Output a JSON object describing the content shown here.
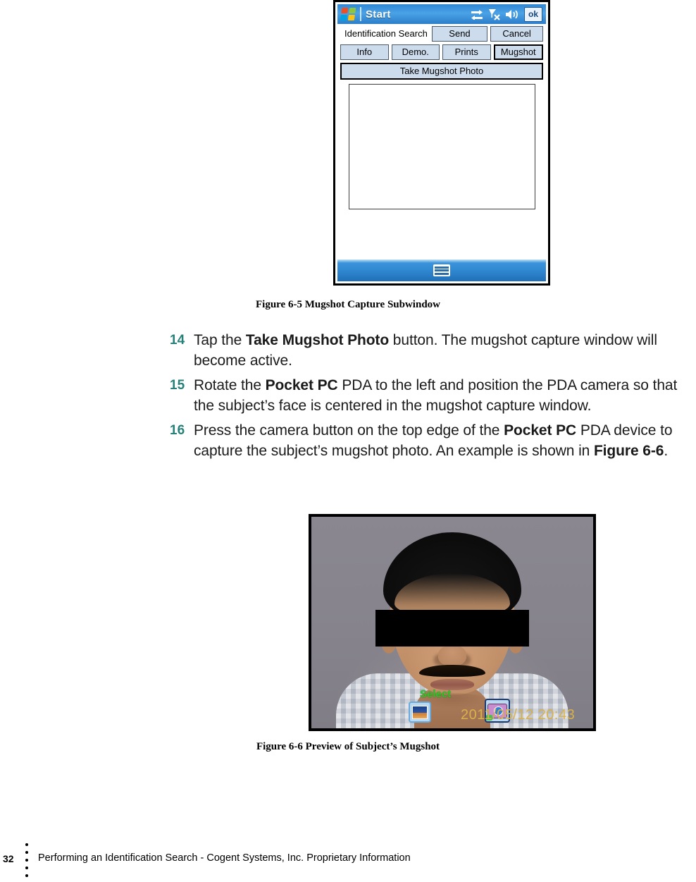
{
  "pda": {
    "titlebar": {
      "start_label": "Start",
      "ok_label": "ok",
      "icons": [
        "connectivity-icon",
        "signal-off-icon",
        "speaker-icon"
      ]
    },
    "command_title": "Identification Search",
    "top_buttons": [
      {
        "label": "Send",
        "selected": false
      },
      {
        "label": "Cancel",
        "selected": false
      }
    ],
    "tabs": [
      {
        "label": "Info",
        "selected": false
      },
      {
        "label": "Demo.",
        "selected": false
      },
      {
        "label": "Prints",
        "selected": false
      },
      {
        "label": "Mugshot",
        "selected": true
      }
    ],
    "take_photo_button": "Take Mugshot Photo",
    "taskbar_icon": "keyboard-icon"
  },
  "captions": {
    "figure_6_5": "Figure 6-5 Mugshot Capture Subwindow",
    "figure_6_6": "Figure 6-6 Preview of Subject’s Mugshot"
  },
  "steps": [
    {
      "number": "14",
      "parts": [
        {
          "text": "Tap the ",
          "bold": false
        },
        {
          "text": "Take Mugshot Photo",
          "bold": true
        },
        {
          "text": " button. The mugshot capture window will become active.",
          "bold": false
        }
      ]
    },
    {
      "number": "15",
      "parts": [
        {
          "text": "Rotate the ",
          "bold": false
        },
        {
          "text": "Pocket PC",
          "bold": true
        },
        {
          "text": " PDA to the left and position the PDA camera so that the subject’s face is centered in the mugshot capture window.",
          "bold": false
        }
      ]
    },
    {
      "number": "16",
      "parts": [
        {
          "text": "Press the camera button on the top edge of the ",
          "bold": false
        },
        {
          "text": "Pocket PC",
          "bold": true
        },
        {
          "text": " PDA device to capture the subject’s mugshot photo. An example is shown in ",
          "bold": false
        },
        {
          "text": "Figure 6-6",
          "bold": true
        },
        {
          "text": ".",
          "bold": false
        }
      ]
    }
  ],
  "mugshot_overlay": {
    "select_label": "Select",
    "timestamp": "2011/05/12 20:43",
    "picture_icon": "picture-icon",
    "camera_icon": "camera-icon"
  },
  "footer": {
    "page_number": "32",
    "text": "Performing an Identification Search  - Cogent Systems, Inc. Proprietary Information"
  },
  "colors": {
    "step_number": "#27807a",
    "titlebar_blue": "#3a8fd6",
    "button_face": "#ccdced",
    "overlay_green": "#22cc22",
    "overlay_amber": "#d8b14a"
  }
}
